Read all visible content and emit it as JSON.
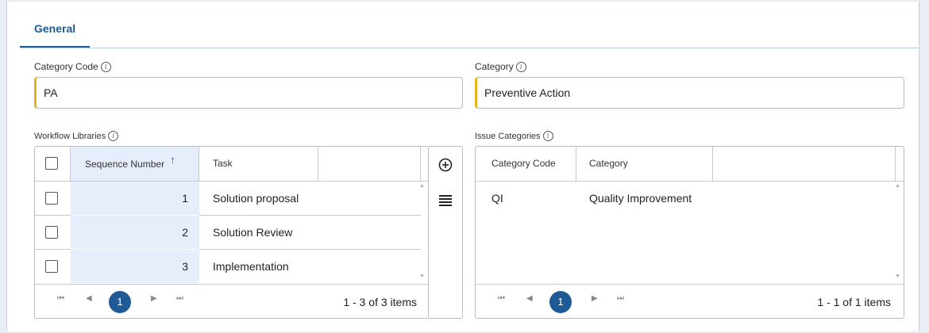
{
  "tabs": {
    "general": "General"
  },
  "fields": {
    "category_code": {
      "label": "Category Code",
      "value": "PA"
    },
    "category": {
      "label": "Category",
      "value": "Preventive Action"
    }
  },
  "workflow": {
    "label": "Workflow Libraries",
    "columns": {
      "seq": "Sequence Number",
      "task": "Task"
    },
    "sort_icon": "arrow-up-icon",
    "rows": [
      {
        "seq": "1",
        "task": "Solution proposal"
      },
      {
        "seq": "2",
        "task": "Solution Review"
      },
      {
        "seq": "3",
        "task": "Implementation"
      }
    ],
    "pager": {
      "page": "1",
      "info": "1 - 3 of 3 items"
    },
    "actions": {
      "add_icon": "plus-circle-icon",
      "menu_icon": "hamburger-menu-icon"
    }
  },
  "issues": {
    "label": "Issue Categories",
    "columns": {
      "code": "Category Code",
      "category": "Category"
    },
    "rows": [
      {
        "code": "QI",
        "category": "Quality Improvement"
      }
    ],
    "pager": {
      "page": "1",
      "info": "1 - 1 of 1 items"
    }
  }
}
